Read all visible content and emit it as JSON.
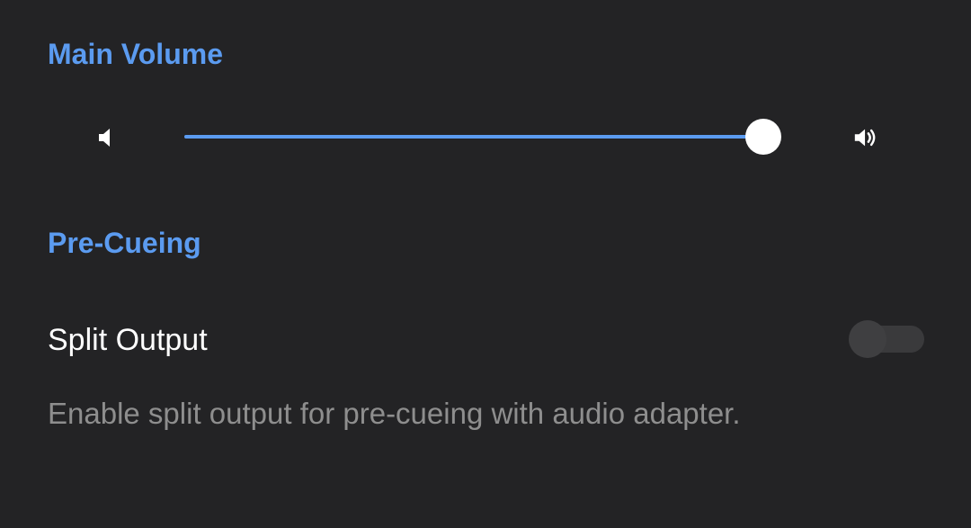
{
  "main_volume": {
    "header": "Main Volume",
    "volume_down_icon": "volume-low-icon",
    "volume_up_icon": "volume-high-icon",
    "slider_value": 0.99,
    "accent_color": "#5B9BF0"
  },
  "pre_cueing": {
    "header": "Pre-Cueing",
    "split_output": {
      "title": "Split Output",
      "description": "Enable split output for pre-cueing with audio adapter.",
      "enabled": false
    }
  },
  "colors": {
    "background": "#232325",
    "accent": "#5B9BF0",
    "primary_text": "#FFFFFF",
    "secondary_text": "#8E8E8E"
  }
}
